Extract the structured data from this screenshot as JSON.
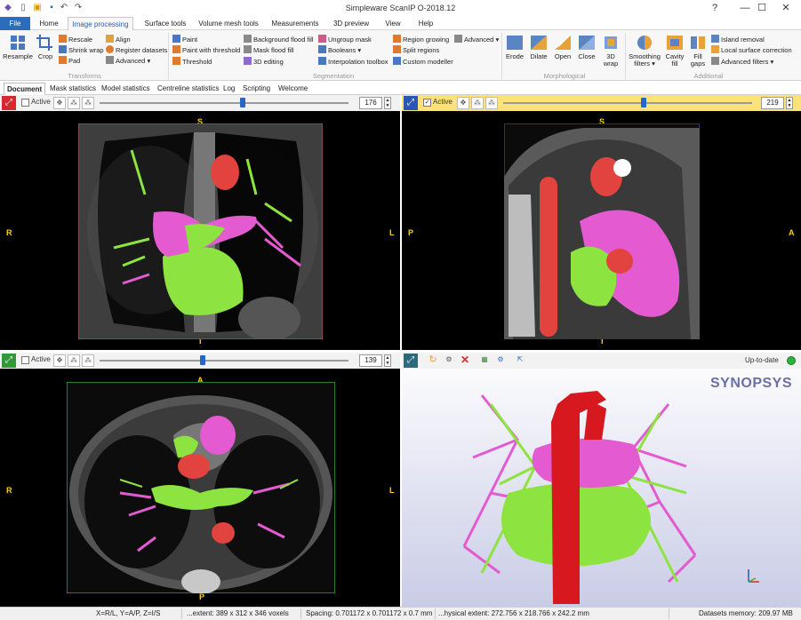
{
  "app": {
    "title": "Simpleware ScanIP O-2018.12"
  },
  "window_controls": {
    "help": "?",
    "minimize": "—",
    "maximize": "☐",
    "close": "✕"
  },
  "menu_tabs": [
    {
      "label": "File"
    },
    {
      "label": "Home"
    },
    {
      "label": "Image processing"
    },
    {
      "label": "Surface tools"
    },
    {
      "label": "Volume mesh tools"
    },
    {
      "label": "Measurements"
    },
    {
      "label": "3D preview"
    },
    {
      "label": "View"
    },
    {
      "label": "Help"
    }
  ],
  "ribbon": {
    "transforms": {
      "resample": "Resample",
      "crop": "Crop",
      "rescale": "Rescale",
      "shrink_wrap": "Shrink wrap",
      "pad": "Pad",
      "align": "Align",
      "register_datasets": "Register datasets",
      "advanced": "Advanced ▾",
      "group": "Transforms"
    },
    "segmentation": {
      "paint": "Paint",
      "paint_threshold": "Paint with threshold",
      "threshold": "Threshold",
      "bg_flood": "Background flood fill",
      "mask_flood": "Mask flood fill",
      "editing_3d": "3D editing",
      "ungroup_mask": "Ungroup mask",
      "booleans": "Booleans ▾",
      "interp_toolbox": "Interpolation toolbox",
      "region_growing": "Region growing",
      "split_regions": "Split regions",
      "custom_modeller": "Custom modeller",
      "advanced": "Advanced ▾",
      "group": "Segmentation"
    },
    "morphological": {
      "erode": "Erode",
      "dilate": "Dilate",
      "open": "Open",
      "close": "Close",
      "wrap3d": "3D wrap",
      "group": "Morphological"
    },
    "additional": {
      "smoothing": "Smoothing filters ▾",
      "cavity_fill": "Cavity fill",
      "fill_gaps": "Fill gaps",
      "island_removal": "Island removal",
      "local_surface": "Local surface correction",
      "advanced_filters": "Advanced filters ▾",
      "group": "Additional"
    }
  },
  "doc_tabs": [
    {
      "label": "Document"
    },
    {
      "label": "Mask statistics"
    },
    {
      "label": "Model statistics"
    },
    {
      "label": "Centreline statistics"
    },
    {
      "label": "Log"
    },
    {
      "label": "Scripting"
    },
    {
      "label": "Welcome"
    }
  ],
  "views": {
    "axial_top": {
      "active_label": "Active",
      "slice": "176",
      "labels": {
        "top": "S",
        "bottom": "I",
        "left": "R",
        "right": "L"
      },
      "slider_value": 0.5
    },
    "sagittal": {
      "active_label": "Active",
      "slice": "219",
      "labels": {
        "top": "S",
        "bottom": "I",
        "left": "P",
        "right": "A"
      },
      "slider_value": 0.55
    },
    "coronal": {
      "active_label": "Active",
      "slice": "139",
      "labels": {
        "top": "A",
        "bottom": "P",
        "left": "R",
        "right": "L"
      },
      "slider_value": 0.4
    },
    "preview3d": {
      "status": "Up-to-date",
      "logo": "SYNOPSYS"
    }
  },
  "status": {
    "coords": "X=R/L, Y=A/P, Z=I/S",
    "extent": "...extent: 389 x 312 x 346 voxels",
    "spacing": "Spacing: 0.701172 x 0.701172 x 0.7 mm",
    "physical": "...hysical extent: 272.756 x 218.766 x 242.2 mm",
    "memory": "Datasets memory: 209.97 MB"
  },
  "colors": {
    "green_mask": "#8de33f",
    "pink_mask": "#e35ad1",
    "red_mask": "#e2433f",
    "accent": "#2b6cbf",
    "orientation": "#ffd400"
  }
}
